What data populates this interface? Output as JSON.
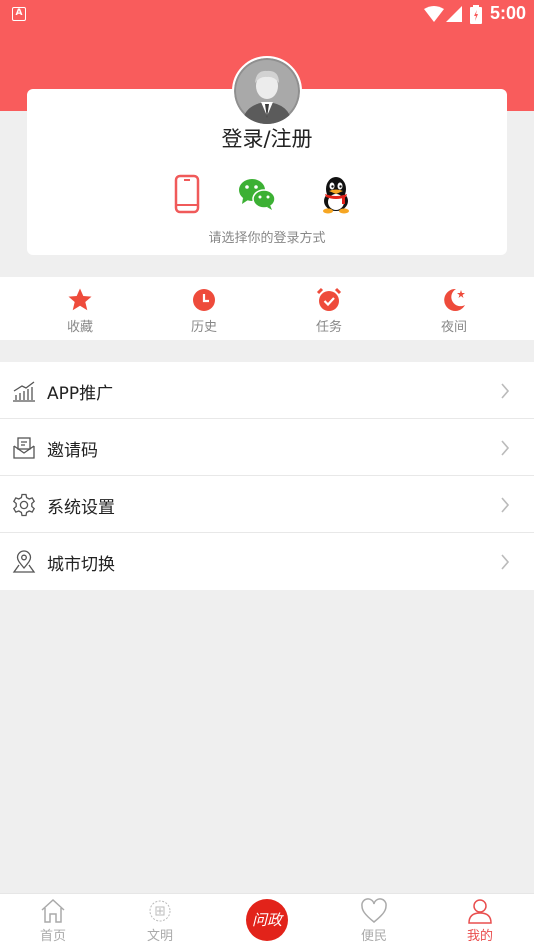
{
  "status_bar": {
    "app_badge": "A",
    "time": "5:00",
    "icons": [
      "wifi-icon",
      "signal-icon",
      "battery-icon"
    ]
  },
  "login": {
    "title": "登录/注册",
    "hint": "请选择你的登录方式",
    "methods": [
      "phone-icon",
      "wechat-icon",
      "qq-icon"
    ]
  },
  "quick_actions": [
    {
      "label": "收藏",
      "icon": "star-icon"
    },
    {
      "label": "历史",
      "icon": "clock-icon"
    },
    {
      "label": "任务",
      "icon": "alarm-clock-icon"
    },
    {
      "label": "夜间",
      "icon": "moon-icon"
    }
  ],
  "menu": [
    {
      "label": "APP推广",
      "icon": "chart-icon"
    },
    {
      "label": "邀请码",
      "icon": "envelope-icon"
    },
    {
      "label": "系统设置",
      "icon": "gear-icon"
    },
    {
      "label": "城市切换",
      "icon": "location-pin-icon"
    }
  ],
  "tabbar": {
    "items": [
      {
        "label": "首页",
        "icon": "home-icon"
      },
      {
        "label": "文明",
        "icon": "emblem-icon"
      },
      {
        "label": "问政",
        "icon": "wenzheng-logo"
      },
      {
        "label": "便民",
        "icon": "heart-icon"
      },
      {
        "label": "我的",
        "icon": "user-icon"
      }
    ],
    "active": "我的"
  },
  "colors": {
    "accent": "#f95c5c",
    "active_tab": "#e94e4e",
    "logo_red": "#e2231a",
    "background": "#efefef"
  }
}
